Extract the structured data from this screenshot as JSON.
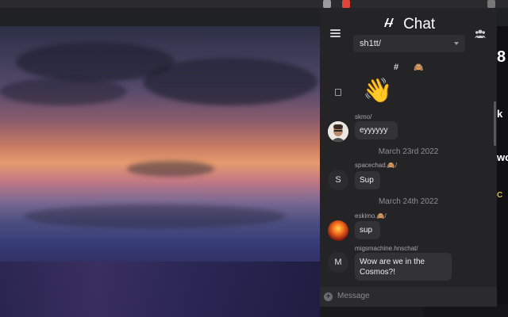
{
  "chat": {
    "title": "Chat",
    "channel": "sh1tt/",
    "tabs": {
      "hash": "#",
      "emoji": "🙈"
    },
    "wave_emoji": "👋",
    "messages": [
      {
        "user": "skmo/",
        "text": "eyyyyyy"
      },
      {
        "date": "March 23rd 2022"
      },
      {
        "user": "spacechad.🙈/",
        "avatar_letter": "S",
        "text": "Sup"
      },
      {
        "date": "March 24th 2022"
      },
      {
        "user": "eskimo.🙈/",
        "text": "sup"
      },
      {
        "user": "migsmachine.hnschat/",
        "avatar_letter": "M",
        "text": "Wow are we in the Cosmos?!"
      }
    ],
    "input_placeholder": "Message"
  },
  "right_strip": {
    "c1": "8",
    "c2": "k",
    "c3": "wo",
    "c4": "C"
  },
  "colors": {
    "panel": "#242426",
    "bubble": "#333337",
    "accent_white": "#ffffff"
  }
}
